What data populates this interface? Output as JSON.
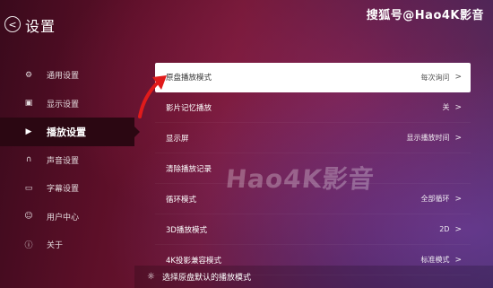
{
  "header": {
    "back_glyph": "<",
    "title": "设置",
    "watermark": "搜狐号@Hao4K影音"
  },
  "sidebar": {
    "items": [
      {
        "label": "通用设置",
        "icon": "gear-icon",
        "glyph": "⚙",
        "active": false
      },
      {
        "label": "显示设置",
        "icon": "display-icon",
        "glyph": "▣",
        "active": false
      },
      {
        "label": "播放设置",
        "icon": "play-icon",
        "glyph": "▶",
        "active": true
      },
      {
        "label": "声音设置",
        "icon": "headphones-icon",
        "glyph": "∩",
        "active": false
      },
      {
        "label": "字幕设置",
        "icon": "subtitle-icon",
        "glyph": "▭",
        "active": false
      },
      {
        "label": "用户中心",
        "icon": "user-icon",
        "glyph": "☺",
        "active": false
      },
      {
        "label": "关于",
        "icon": "info-icon",
        "glyph": "ⓘ",
        "active": false
      }
    ]
  },
  "menu": {
    "rows": [
      {
        "label": "原盘播放模式",
        "value": "每次询问",
        "highlighted": true
      },
      {
        "label": "影片记忆播放",
        "value": "关",
        "highlighted": false
      },
      {
        "label": "显示屏",
        "value": "显示播放时间",
        "highlighted": false
      },
      {
        "label": "清除播放记录",
        "value": "",
        "highlighted": false
      },
      {
        "label": "循环模式",
        "value": "全部循环",
        "highlighted": false
      },
      {
        "label": "3D播放模式",
        "value": "2D",
        "highlighted": false
      },
      {
        "label": "4K投影兼容模式",
        "value": "标准模式",
        "highlighted": false
      }
    ],
    "chevron": ">"
  },
  "watermark_center": "Hao4K影音",
  "hint": {
    "icon": "bulb-icon",
    "glyph": "☼",
    "text": "选择原盘默认的播放模式"
  },
  "colors": {
    "accent_active": "#2b0712",
    "highlight_row": "#ffffff",
    "annotation_arrow": "#e01b1b"
  }
}
